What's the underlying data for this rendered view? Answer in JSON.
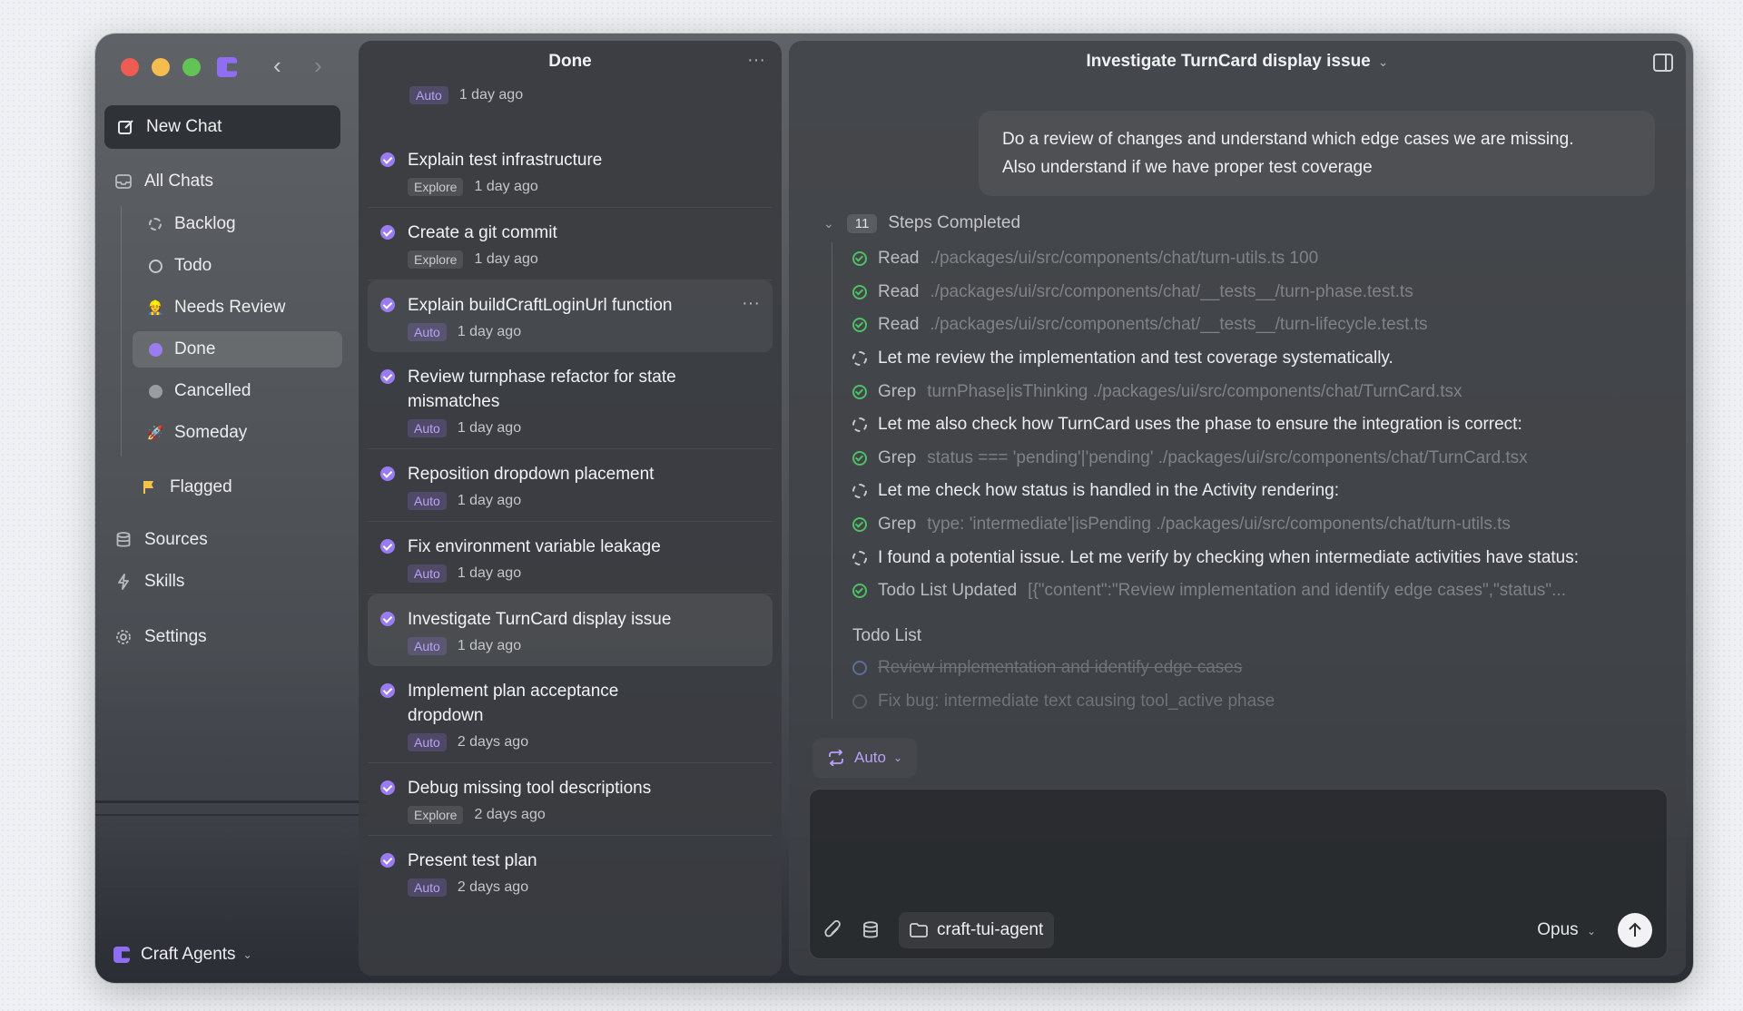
{
  "sidebar": {
    "new_chat": "New Chat",
    "all_chats": "All Chats",
    "statuses": [
      {
        "label": "Backlog",
        "icon": "dashed-circle-icon"
      },
      {
        "label": "Todo",
        "icon": "circle-icon"
      },
      {
        "label": "Needs Review",
        "icon": "review-emoji-icon"
      },
      {
        "label": "Done",
        "icon": "done-check-icon",
        "active": true
      },
      {
        "label": "Cancelled",
        "icon": "cancelled-x-icon"
      },
      {
        "label": "Someday",
        "icon": "rocket-icon"
      }
    ],
    "flagged": "Flagged",
    "sources": "Sources",
    "skills": "Skills",
    "settings": "Settings",
    "workspace": "Craft Agents"
  },
  "list": {
    "title": "Done",
    "first_tag": "Auto",
    "first_time": "1 day ago",
    "items": [
      {
        "title": "Explain test infrastructure",
        "tag": "Explore",
        "time": "1 day ago"
      },
      {
        "title": "Create a git commit",
        "tag": "Explore",
        "time": "1 day ago"
      },
      {
        "title": "Explain buildCraftLoginUrl function",
        "tag": "Auto",
        "time": "1 day ago"
      },
      {
        "title": "Review turnphase refactor for state mismatches",
        "tag": "Auto",
        "time": "1 day ago"
      },
      {
        "title": "Reposition dropdown placement",
        "tag": "Auto",
        "time": "1 day ago"
      },
      {
        "title": "Fix environment variable leakage",
        "tag": "Auto",
        "time": "1 day ago"
      },
      {
        "title": "Investigate TurnCard display issue",
        "tag": "Auto",
        "time": "1 day ago"
      },
      {
        "title": "Implement plan acceptance dropdown",
        "tag": "Auto",
        "time": "2 days ago"
      },
      {
        "title": "Debug missing tool descriptions",
        "tag": "Explore",
        "time": "2 days ago"
      },
      {
        "title": "Present test plan",
        "tag": "Auto",
        "time": "2 days ago"
      }
    ]
  },
  "chat": {
    "title": "Investigate TurnCard display issue",
    "user_message_line1": "Do a review of changes and understand which edge cases we are missing.",
    "user_message_line2": "Also understand if we have proper test coverage",
    "steps_count": "11",
    "steps_label": "Steps Completed",
    "steps": [
      {
        "kind": "tool",
        "tool": "Read",
        "arg": "./packages/ui/src/components/chat/turn-utils.ts 100"
      },
      {
        "kind": "tool",
        "tool": "Read",
        "arg": "./packages/ui/src/components/chat/__tests__/turn-phase.test.ts"
      },
      {
        "kind": "tool",
        "tool": "Read",
        "arg": "./packages/ui/src/components/chat/__tests__/turn-lifecycle.test.ts"
      },
      {
        "kind": "thought",
        "text": "Let me review the implementation and test coverage systematically."
      },
      {
        "kind": "tool",
        "tool": "Grep",
        "arg": "turnPhase|isThinking ./packages/ui/src/components/chat/TurnCard.tsx"
      },
      {
        "kind": "thought",
        "text": "Let me also check how TurnCard uses the phase to ensure the integration is correct:"
      },
      {
        "kind": "tool",
        "tool": "Grep",
        "arg": "status === 'pending'|'pending' ./packages/ui/src/components/chat/TurnCard.tsx"
      },
      {
        "kind": "thought",
        "text": "Let me check how status is handled in the Activity rendering:"
      },
      {
        "kind": "tool",
        "tool": "Grep",
        "arg": "type: 'intermediate'|isPending ./packages/ui/src/components/chat/turn-utils.ts"
      },
      {
        "kind": "thought",
        "text": "I found a potential issue. Let me verify by checking when intermediate activities have status:"
      },
      {
        "kind": "tool",
        "tool": "Todo List Updated",
        "arg": "[{\"content\":\"Review implementation and identify edge cases\",\"status\"..."
      }
    ],
    "todo_heading": "Todo List",
    "todos": [
      {
        "text": "Review implementation and identify edge cases",
        "done": true
      },
      {
        "text": "Fix bug: intermediate text causing tool_active phase",
        "done": false
      }
    ],
    "mode": "Auto",
    "directory": "craft-tui-agent",
    "model": "Opus"
  }
}
